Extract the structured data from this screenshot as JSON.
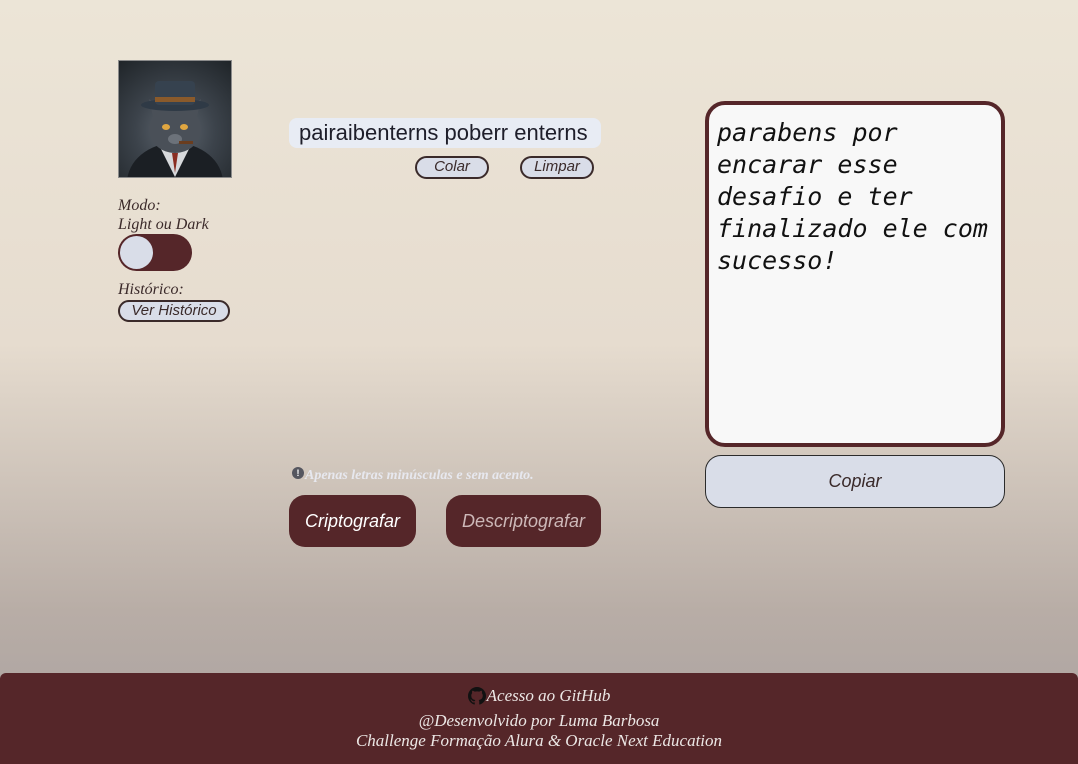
{
  "colors": {
    "accent": "#552629",
    "button_bg": "#d9dde8",
    "output_bg": "#f8f8f8"
  },
  "sidebar": {
    "avatar_icon": "cat-avatar",
    "mode_label_line1": "Modo:",
    "mode_label_line2": "Light ou Dark",
    "toggle_state": "light",
    "history_label": "Histórico:",
    "history_button": "Ver Histórico"
  },
  "input": {
    "value": "pairaibenterns poberr enterns "
  },
  "input_actions": {
    "paste_label": "Colar",
    "clear_label": "Limpar"
  },
  "warning": {
    "icon": "exclamation-circle-icon",
    "text": "Apenas letras minúsculas e sem acento."
  },
  "actions": {
    "encrypt_label": "Criptografar",
    "decrypt_label": "Descriptografar"
  },
  "output": {
    "text": "parabens por encarar esse desafio e ter finalizado ele com sucesso!",
    "copy_label": "Copiar"
  },
  "footer": {
    "github_icon": "github-icon",
    "github_label": "Acesso ao GitHub",
    "credit": "@Desenvolvido por Luma Barbosa",
    "challenge": "Challenge Formação Alura & Oracle Next Education"
  }
}
